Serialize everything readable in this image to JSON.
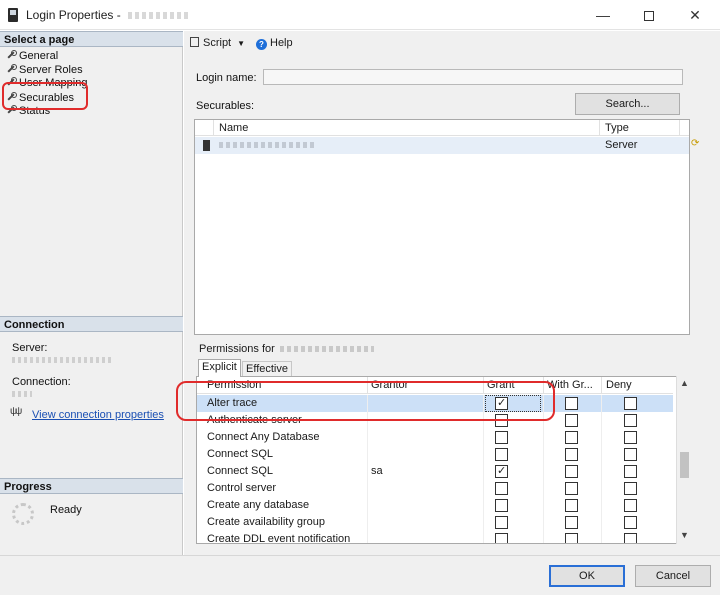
{
  "window": {
    "title": "Login Properties - ",
    "minimize_glyph": "—",
    "close_glyph": "✕"
  },
  "left": {
    "select_page_header": "Select a page",
    "pages": [
      {
        "label": "General"
      },
      {
        "label": "Server Roles"
      },
      {
        "label": "User Mapping"
      },
      {
        "label": "Securables"
      },
      {
        "label": "Status"
      }
    ],
    "connection_header": "Connection",
    "server_label": "Server:",
    "connection_label": "Connection:",
    "view_connection_link": "View connection properties",
    "progress_header": "Progress",
    "progress_status": "Ready"
  },
  "toolbar": {
    "script_label": "Script",
    "help_label": "Help"
  },
  "form": {
    "login_name_label": "Login name:",
    "login_name_value": "",
    "securables_label": "Securables:",
    "search_button": "Search..."
  },
  "securables_grid": {
    "columns": [
      "Name",
      "Type"
    ],
    "rows": [
      {
        "type": "Server"
      }
    ]
  },
  "permissions": {
    "title": "Permissions for",
    "tabs": [
      "Explicit",
      "Effective"
    ],
    "columns": [
      "Permission",
      "Grantor",
      "Grant",
      "With Gr...",
      "Deny"
    ],
    "rows": [
      {
        "permission": "Alter trace",
        "grantor": "",
        "grant": true,
        "with_grant": false,
        "deny": false,
        "selected": true
      },
      {
        "permission": "Authenticate server",
        "grantor": "",
        "grant": false,
        "with_grant": false,
        "deny": false
      },
      {
        "permission": "Connect Any Database",
        "grantor": "",
        "grant": false,
        "with_grant": false,
        "deny": false
      },
      {
        "permission": "Connect SQL",
        "grantor": "",
        "grant": false,
        "with_grant": false,
        "deny": false
      },
      {
        "permission": "Connect SQL",
        "grantor": "sa",
        "grant": true,
        "with_grant": false,
        "deny": false
      },
      {
        "permission": "Control server",
        "grantor": "",
        "grant": false,
        "with_grant": false,
        "deny": false
      },
      {
        "permission": "Create any database",
        "grantor": "",
        "grant": false,
        "with_grant": false,
        "deny": false
      },
      {
        "permission": "Create availability group",
        "grantor": "",
        "grant": false,
        "with_grant": false,
        "deny": false
      },
      {
        "permission": "Create DDL event notification",
        "grantor": "",
        "grant": false,
        "with_grant": false,
        "deny": false
      }
    ]
  },
  "buttons": {
    "ok": "OK",
    "cancel": "Cancel"
  },
  "colors": {
    "highlight_red": "#e02b2b",
    "selected_row": "#cce0f7",
    "pane_header": "#d9e1ea",
    "link_blue": "#1a4fb3"
  }
}
